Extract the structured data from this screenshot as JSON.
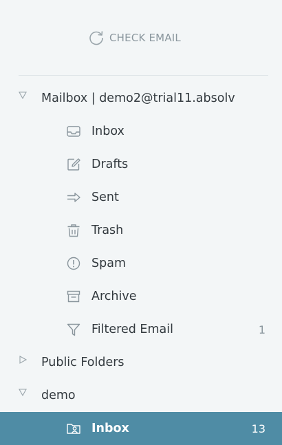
{
  "toolbar": {
    "check_email_label": "CHECK EMAIL"
  },
  "mailbox": {
    "label": "Mailbox | demo2@trial11.absolv",
    "folders": [
      {
        "label": "Inbox",
        "icon": "inbox-icon",
        "count": ""
      },
      {
        "label": "Drafts",
        "icon": "drafts-icon",
        "count": ""
      },
      {
        "label": "Sent",
        "icon": "sent-icon",
        "count": ""
      },
      {
        "label": "Trash",
        "icon": "trash-icon",
        "count": ""
      },
      {
        "label": "Spam",
        "icon": "spam-icon",
        "count": ""
      },
      {
        "label": "Archive",
        "icon": "archive-icon",
        "count": ""
      },
      {
        "label": "Filtered Email",
        "icon": "filter-icon",
        "count": "1"
      }
    ]
  },
  "public_folders": {
    "label": "Public Folders"
  },
  "demo": {
    "label": "demo",
    "folders": [
      {
        "label": "Inbox",
        "icon": "shared-inbox-icon",
        "count": "13"
      }
    ]
  },
  "colors": {
    "background": "#f3f6f7",
    "selected_row": "#4f8ca5",
    "muted_text": "#8a969d",
    "text": "#333a3f"
  }
}
